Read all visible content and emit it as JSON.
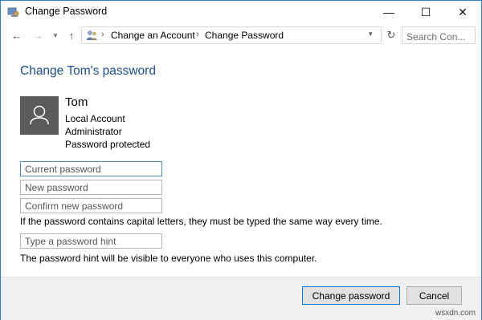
{
  "window": {
    "title": "Change Password",
    "minimize": "—",
    "maximize": "☐",
    "close": "✕"
  },
  "nav": {
    "back": "←",
    "forward": "→",
    "recent": "▾",
    "up": "↑",
    "breadcrumbs": [
      "Change an Account",
      "Change Password"
    ],
    "separator": "›",
    "dropdown": "▾",
    "refresh": "↻",
    "search_placeholder": "Search Con..."
  },
  "main": {
    "title": "Change Tom's password",
    "user": {
      "name": "Tom",
      "details": [
        "Local Account",
        "Administrator",
        "Password protected"
      ]
    },
    "fields": {
      "current_placeholder": "Current password",
      "new_placeholder": "New password",
      "confirm_placeholder": "Confirm new password",
      "hint_placeholder": "Type a password hint"
    },
    "note_caps": "If the password contains capital letters, they must be typed the same way every time.",
    "note_hint": "The password hint will be visible to everyone who uses this computer."
  },
  "footer": {
    "primary": "Change password",
    "cancel": "Cancel",
    "watermark": "wsxdn.com"
  },
  "colors": {
    "accent": "#0078d7",
    "title_text": "#1e4e8c",
    "avatar_bg": "#5b5b5b"
  },
  "icons": [
    "control-panel-icon",
    "user-accounts-icon",
    "user-avatar-icon"
  ]
}
